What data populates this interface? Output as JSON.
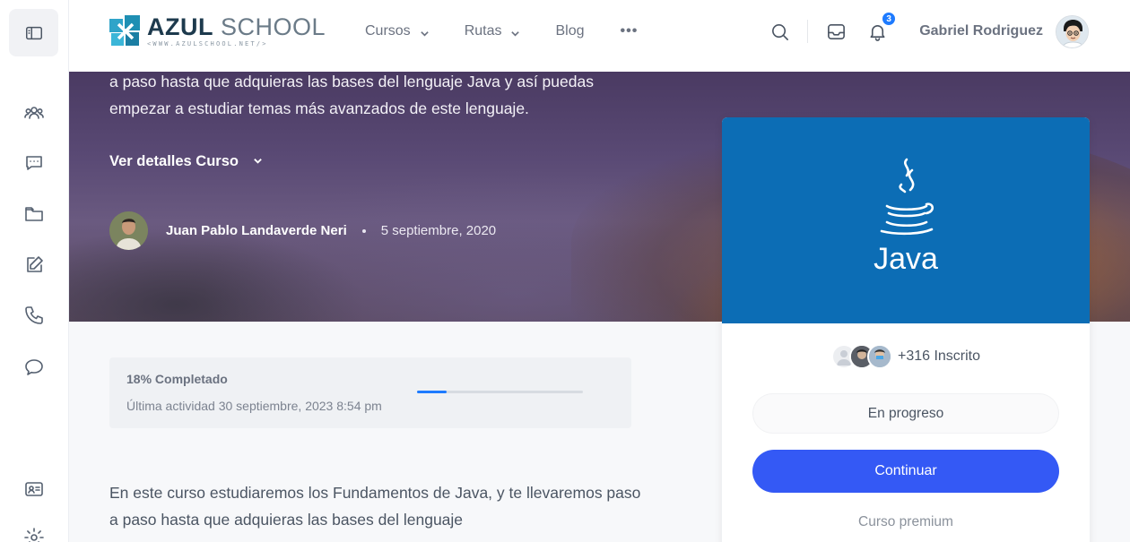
{
  "header": {
    "logo": {
      "main_bold": "AZUL",
      "main_light": "SCHOOL",
      "sub": "<WWW.AZULSCHOOL.NET/>"
    },
    "nav": [
      {
        "label": "Cursos",
        "has_dropdown": true
      },
      {
        "label": "Rutas",
        "has_dropdown": true
      },
      {
        "label": "Blog",
        "has_dropdown": false
      }
    ],
    "more_label": "•••",
    "notifications_count": "3",
    "user_name": "Gabriel Rodriguez",
    "icons": [
      "search-icon",
      "inbox-icon",
      "bell-icon"
    ]
  },
  "sidebar": {
    "items": [
      "sidebar-toggle-icon",
      "users-icon",
      "chat-icon",
      "folder-icon",
      "edit-icon",
      "phone-icon",
      "message-icon",
      "id-card-icon",
      "settings-icon"
    ]
  },
  "hero": {
    "description": "a paso hasta que adquieras las bases del lenguaje Java y así puedas empezar a estudiar temas más avanzados de este lenguaje.",
    "details_label": "Ver detalles Curso",
    "author_name": "Juan Pablo Landaverde Neri",
    "date": "5 septiembre, 2020"
  },
  "progress": {
    "percent": 18,
    "title": "18% Completado",
    "last_activity": "Última actividad 30 septiembre, 2023 8:54 pm"
  },
  "body": {
    "text": "En este curso estudiaremos los Fundamentos de Java, y te llevaremos paso a paso hasta que adquieras las bases del lenguaje"
  },
  "course_card": {
    "banner_text": "Java",
    "banner_color": "#0c6db5",
    "enrolled_text": "+316 Inscrito",
    "status": "En progreso",
    "continue_label": "Continuar",
    "premium_label": "Curso premium",
    "accent": "#3459f5"
  }
}
